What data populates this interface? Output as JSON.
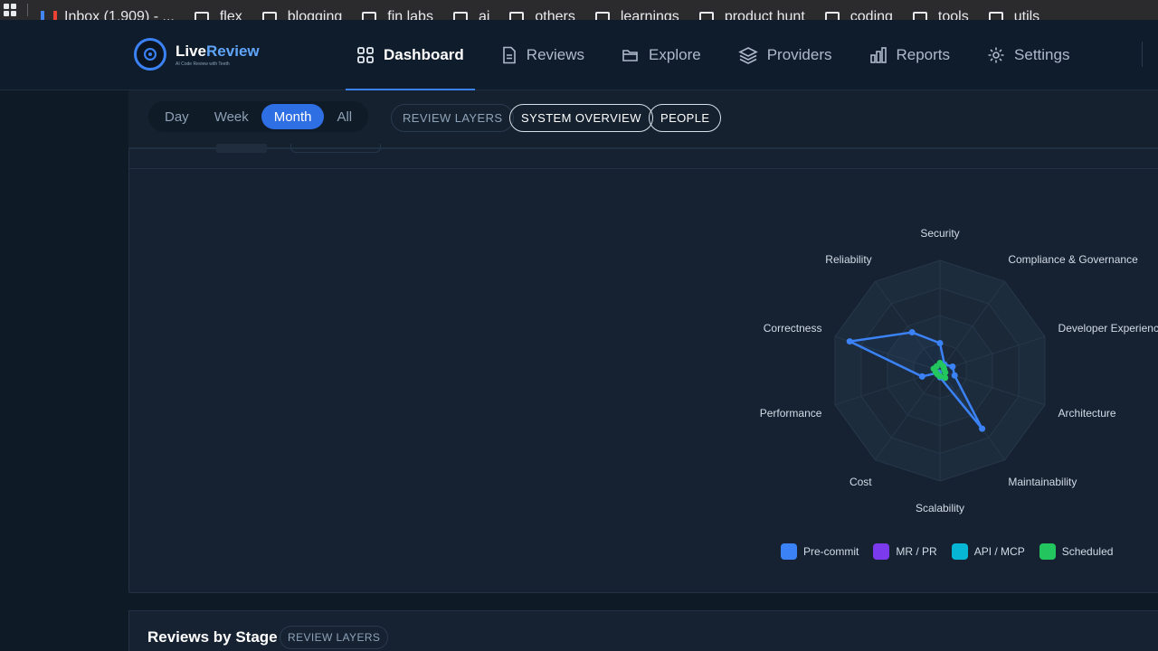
{
  "browser": {
    "bookmarks": [
      {
        "label": "Inbox (1,909) - ...",
        "icon": "gmail-icon"
      },
      {
        "label": "flex",
        "icon": "folder-icon"
      },
      {
        "label": "blogging",
        "icon": "folder-icon"
      },
      {
        "label": "fin labs",
        "icon": "folder-icon"
      },
      {
        "label": "ai",
        "icon": "folder-icon"
      },
      {
        "label": "others",
        "icon": "folder-icon"
      },
      {
        "label": "learnings",
        "icon": "folder-icon"
      },
      {
        "label": "product hunt",
        "icon": "folder-icon"
      },
      {
        "label": "coding",
        "icon": "folder-icon"
      },
      {
        "label": "tools",
        "icon": "folder-icon"
      },
      {
        "label": "utils",
        "icon": "folder-icon"
      }
    ]
  },
  "header": {
    "logo_name_a": "Live",
    "logo_name_b": "Review",
    "logo_tagline": "AI Code Review with Teeth",
    "nav": [
      {
        "label": "Dashboard",
        "icon": "grid-icon",
        "active": true
      },
      {
        "label": "Reviews",
        "icon": "document-icon",
        "active": false
      },
      {
        "label": "Explore",
        "icon": "folder-open-icon",
        "active": false
      },
      {
        "label": "Providers",
        "icon": "layers-icon",
        "active": false
      },
      {
        "label": "Reports",
        "icon": "bar-chart-icon",
        "active": false
      },
      {
        "label": "Settings",
        "icon": "gear-icon",
        "active": false
      }
    ]
  },
  "filters": {
    "periods": [
      "Day",
      "Week",
      "Month",
      "All"
    ],
    "active_period": "Month",
    "views": [
      {
        "label": "REVIEW LAYERS",
        "style": "dim"
      },
      {
        "label": "SYSTEM OVERVIEW",
        "style": "bright"
      },
      {
        "label": "PEOPLE",
        "style": "bright"
      }
    ]
  },
  "chart_data": {
    "type": "radar",
    "axes": [
      "Security",
      "Compliance & Governance",
      "Developer Experience",
      "Architecture",
      "Maintainability",
      "Scalability",
      "Cost",
      "Performance",
      "Correctness",
      "Reliability"
    ],
    "rlim": [
      0,
      100
    ],
    "rings": 4,
    "series": [
      {
        "name": "Pre-commit",
        "color": "#3b82f6",
        "values": [
          25,
          7,
          12,
          14,
          65,
          6,
          2,
          17,
          86,
          43
        ]
      },
      {
        "name": "MR / PR",
        "color": "#7c3aed",
        "values": [
          0,
          0,
          0,
          0,
          0,
          0,
          0,
          0,
          0,
          0
        ]
      },
      {
        "name": "API / MCP",
        "color": "#06b6d4",
        "values": [
          0,
          0,
          0,
          0,
          0,
          0,
          0,
          0,
          0,
          0
        ]
      },
      {
        "name": "Scheduled",
        "color": "#22c55e",
        "values": [
          7,
          5,
          4,
          5,
          8,
          5,
          4,
          4,
          6,
          5
        ]
      }
    ],
    "legend": "bottom"
  },
  "bottom_card": {
    "title": "Reviews by Stage",
    "badge": "REVIEW LAYERS"
  },
  "colors": {
    "accent": "#3b82f6",
    "background": "#0f1a27",
    "card": "#162232"
  }
}
